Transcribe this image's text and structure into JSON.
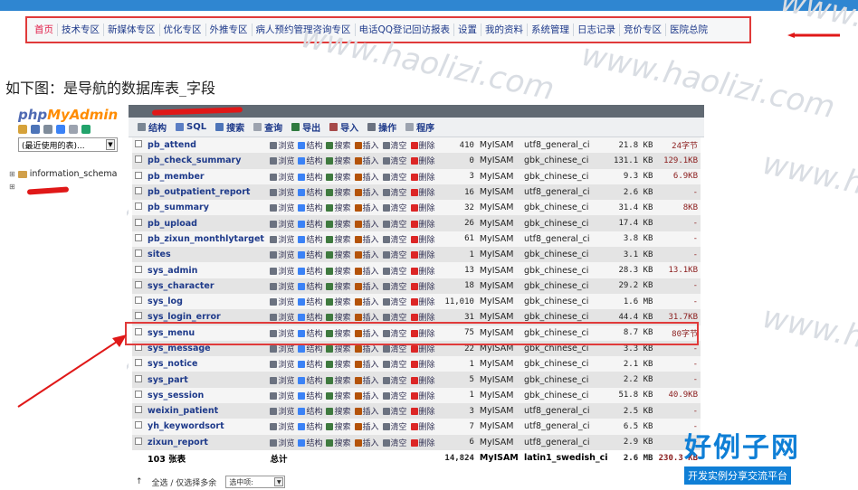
{
  "topnav": {
    "items": [
      "首页",
      "技术专区",
      "新媒体专区",
      "优化专区",
      "外推专区",
      "病人预约管理咨询专区",
      "电话QQ登记回访报表",
      "设置",
      "我的资料",
      "系统管理",
      "日志记录",
      "竞价专区",
      "医院总院"
    ]
  },
  "caption": "如下图：是导航的数据库表_字段",
  "pma": {
    "logo_php": "php",
    "logo_myadmin": "MyAdmin",
    "db_select": "(最近使用的表)...",
    "tree": [
      "information_schema"
    ],
    "tabs": [
      "结构",
      "SQL",
      "搜索",
      "查询",
      "导出",
      "导入",
      "操作",
      "程序"
    ],
    "actions": [
      "浏览",
      "结构",
      "搜索",
      "插入",
      "清空",
      "删除"
    ],
    "rows": [
      {
        "name": "pb_attend",
        "rows": "410",
        "engine": "MyISAM",
        "coll": "utf8_general_ci",
        "size": "21.8 KB",
        "overhead": "24字节"
      },
      {
        "name": "pb_check_summary",
        "rows": "0",
        "engine": "MyISAM",
        "coll": "gbk_chinese_ci",
        "size": "131.1 KB",
        "overhead": "129.1KB"
      },
      {
        "name": "pb_member",
        "rows": "3",
        "engine": "MyISAM",
        "coll": "gbk_chinese_ci",
        "size": "9.3 KB",
        "overhead": "6.9KB"
      },
      {
        "name": "pb_outpatient_report",
        "rows": "16",
        "engine": "MyISAM",
        "coll": "utf8_general_ci",
        "size": "2.6 KB",
        "overhead": "-"
      },
      {
        "name": "pb_summary",
        "rows": "32",
        "engine": "MyISAM",
        "coll": "gbk_chinese_ci",
        "size": "31.4 KB",
        "overhead": "8KB"
      },
      {
        "name": "pb_upload",
        "rows": "26",
        "engine": "MyISAM",
        "coll": "gbk_chinese_ci",
        "size": "17.4 KB",
        "overhead": "-"
      },
      {
        "name": "pb_zixun_monthlytarget",
        "rows": "61",
        "engine": "MyISAM",
        "coll": "utf8_general_ci",
        "size": "3.8 KB",
        "overhead": "-"
      },
      {
        "name": "sites",
        "rows": "1",
        "engine": "MyISAM",
        "coll": "gbk_chinese_ci",
        "size": "3.1 KB",
        "overhead": "-"
      },
      {
        "name": "sys_admin",
        "rows": "13",
        "engine": "MyISAM",
        "coll": "gbk_chinese_ci",
        "size": "28.3 KB",
        "overhead": "13.1KB"
      },
      {
        "name": "sys_character",
        "rows": "18",
        "engine": "MyISAM",
        "coll": "gbk_chinese_ci",
        "size": "29.2 KB",
        "overhead": "-"
      },
      {
        "name": "sys_log",
        "rows": "11,010",
        "engine": "MyISAM",
        "coll": "gbk_chinese_ci",
        "size": "1.6 MB",
        "overhead": "-"
      },
      {
        "name": "sys_login_error",
        "rows": "31",
        "engine": "MyISAM",
        "coll": "gbk_chinese_ci",
        "size": "44.4 KB",
        "overhead": "31.7KB"
      },
      {
        "name": "sys_menu",
        "rows": "75",
        "engine": "MyISAM",
        "coll": "gbk_chinese_ci",
        "size": "8.7 KB",
        "overhead": "80字节"
      },
      {
        "name": "sys_message",
        "rows": "22",
        "engine": "MyISAM",
        "coll": "gbk_chinese_ci",
        "size": "3.3 KB",
        "overhead": "-"
      },
      {
        "name": "sys_notice",
        "rows": "1",
        "engine": "MyISAM",
        "coll": "gbk_chinese_ci",
        "size": "2.1 KB",
        "overhead": "-"
      },
      {
        "name": "sys_part",
        "rows": "5",
        "engine": "MyISAM",
        "coll": "gbk_chinese_ci",
        "size": "2.2 KB",
        "overhead": "-"
      },
      {
        "name": "sys_session",
        "rows": "1",
        "engine": "MyISAM",
        "coll": "gbk_chinese_ci",
        "size": "51.8 KB",
        "overhead": "40.9KB"
      },
      {
        "name": "weixin_patient",
        "rows": "3",
        "engine": "MyISAM",
        "coll": "utf8_general_ci",
        "size": "2.5 KB",
        "overhead": "-"
      },
      {
        "name": "yh_keywordsort",
        "rows": "7",
        "engine": "MyISAM",
        "coll": "utf8_general_ci",
        "size": "6.5 KB",
        "overhead": "-"
      },
      {
        "name": "zixun_report",
        "rows": "6",
        "engine": "MyISAM",
        "coll": "utf8_general_ci",
        "size": "2.9 KB",
        "overhead": "-"
      }
    ],
    "total": {
      "label": "103 张表",
      "sum": "总计",
      "rows": "14,824",
      "engine": "MyISAM",
      "coll": "latin1_swedish_ci",
      "size": "2.6 MB",
      "overhead": "230.3 KB"
    },
    "bottom": {
      "check_all": "全选 / 仅选择多余",
      "with_selected": "选中项:"
    }
  },
  "watermark": "www.haolizi.com",
  "brand": {
    "big": "好例子网",
    "small": "开发实例分享交流平台"
  },
  "colors": {
    "accent": "#e03a3a",
    "link": "#1e3a8a",
    "brand": "#0f7fd6"
  }
}
